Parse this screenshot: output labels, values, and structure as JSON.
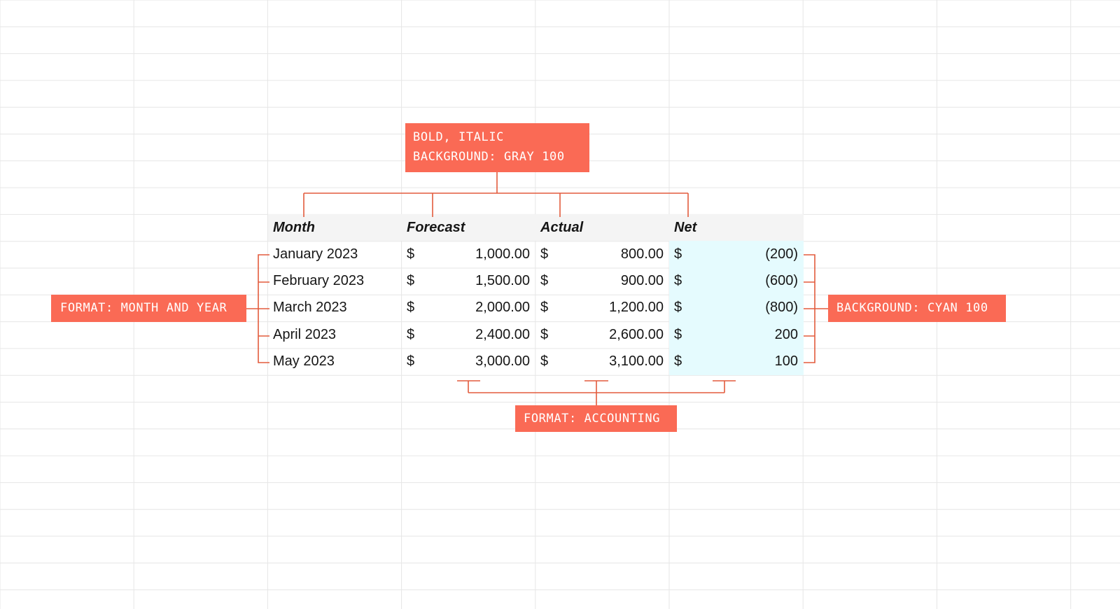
{
  "colors": {
    "accent": "#fa6a55",
    "connector": "#e35b3d",
    "header_bg": "#f4f4f4",
    "net_bg": "#e5fbfe",
    "grid": "#e6e6e6",
    "text": "#161616"
  },
  "table": {
    "headers": [
      "Month",
      "Forecast",
      "Actual",
      "Net"
    ],
    "currency_symbol": "$",
    "rows": [
      {
        "month": "January 2023",
        "forecast": "1,000.00",
        "actual": "800.00",
        "net": "(200)"
      },
      {
        "month": "February 2023",
        "forecast": "1,500.00",
        "actual": "900.00",
        "net": "(600)"
      },
      {
        "month": "March 2023",
        "forecast": "2,000.00",
        "actual": "1,200.00",
        "net": "(800)"
      },
      {
        "month": "April 2023",
        "forecast": "2,400.00",
        "actual": "2,600.00",
        "net": "200"
      },
      {
        "month": "May 2023",
        "forecast": "3,000.00",
        "actual": "3,100.00",
        "net": "100"
      }
    ]
  },
  "callouts": {
    "header_style": {
      "line1": "BOLD, ITALIC",
      "line2": "BACKGROUND: GRAY 100"
    },
    "month_format": "FORMAT: MONTH AND YEAR",
    "net_background": "BACKGROUND: CYAN 100",
    "accounting_format": "FORMAT: ACCOUNTING"
  }
}
